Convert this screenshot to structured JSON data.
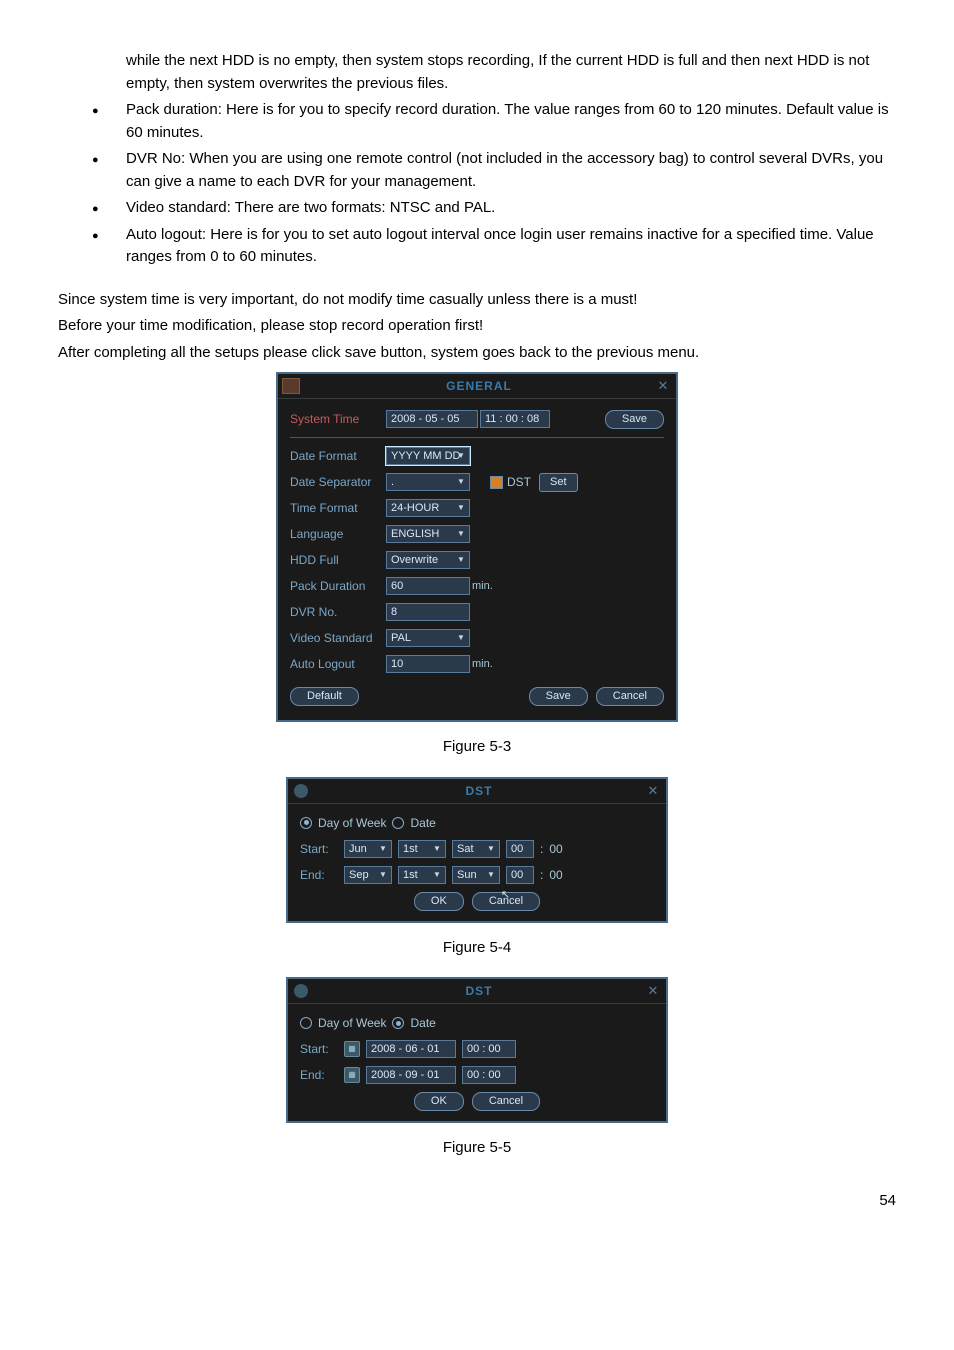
{
  "intro": "while the next HDD is no empty, then system stops recording, If the current HDD is full and then next HDD is not empty, then system overwrites the previous files.",
  "bullets": [
    "Pack duration: Here is for you to specify record duration. The value ranges from 60 to 120 minutes. Default value is 60 minutes.",
    "DVR No: When you are using one remote control (not included in the accessory bag) to control several DVRs, you can give a name to each DVR for your management.",
    "Video standard: There are two formats: NTSC and PAL.",
    "Auto logout: Here is for you to set auto logout interval once login user remains inactive for a specified time. Value ranges from 0 to 60 minutes."
  ],
  "paras": [
    "Since system time is very important, do not modify time casually unless there is a must!",
    "Before your time modification, please stop record operation first!",
    "After completing all the setups please click save button, system goes back to the previous menu."
  ],
  "figcaps": {
    "f53": "Figure 5-3",
    "f54": "Figure 5-4",
    "f55": "Figure 5-5"
  },
  "general": {
    "title": "GENERAL",
    "fields": {
      "system_time_lbl": "System Time",
      "system_time_date": "2008  - 05 - 05",
      "system_time_time": "11 : 00 : 08",
      "save_btn": "Save",
      "date_format_lbl": "Date Format",
      "date_format_val": "YYYY MM DD",
      "date_sep_lbl": "Date Separator",
      "date_sep_val": ".",
      "dst_lbl": "DST",
      "set_btn": "Set",
      "time_format_lbl": "Time Format",
      "time_format_val": "24-HOUR",
      "language_lbl": "Language",
      "language_val": "ENGLISH",
      "hdd_full_lbl": "HDD Full",
      "hdd_full_val": "Overwrite",
      "pack_dur_lbl": "Pack Duration",
      "pack_dur_val": "60",
      "min_unit": "min.",
      "dvr_no_lbl": "DVR No.",
      "dvr_no_val": "8",
      "video_std_lbl": "Video Standard",
      "video_std_val": "PAL",
      "auto_logout_lbl": "Auto Logout",
      "auto_logout_val": "10",
      "default_btn": "Default",
      "cancel_btn": "Cancel"
    }
  },
  "dst1": {
    "title": "DST",
    "day_of_week": "Day of Week",
    "date": "Date",
    "start_lbl": "Start:",
    "end_lbl": "End:",
    "start_month": "Jun",
    "start_week": "1st",
    "start_day": "Sat",
    "start_hh": "00",
    "start_mm": "00",
    "end_month": "Sep",
    "end_week": "1st",
    "end_day": "Sun",
    "end_hh": "00",
    "end_mm": "00",
    "ok": "OK",
    "cancel": "Cancel"
  },
  "dst2": {
    "title": "DST",
    "day_of_week": "Day of Week",
    "date": "Date",
    "start_lbl": "Start:",
    "end_lbl": "End:",
    "start_date": "2008  - 06 - 01",
    "start_time": "00 : 00",
    "end_date": "2008  - 09 - 01",
    "end_time": "00 : 00",
    "ok": "OK",
    "cancel": "Cancel"
  },
  "page": "54"
}
